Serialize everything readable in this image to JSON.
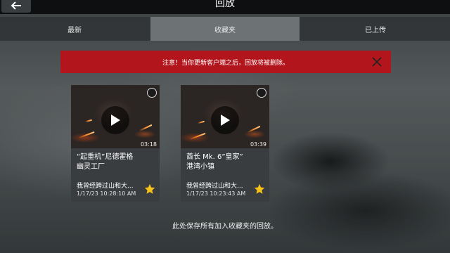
{
  "header": {
    "title": "回放"
  },
  "tabs": [
    {
      "label": "最新",
      "active": false
    },
    {
      "label": "收藏夹",
      "active": true
    },
    {
      "label": "已上传",
      "active": false
    }
  ],
  "notice": {
    "text": "注意！当你更新客户端之后，回放将被删除。"
  },
  "cards": [
    {
      "title_line1": "“起重机”尼德霍格",
      "title_line2": "幽灵工厂",
      "duration": "03:18",
      "description": "我曾经跨过山和大...",
      "date": "1/17/23 10:28:10 AM",
      "favorited": true
    },
    {
      "title_line1": "酋长 Mk. 6”皇家”",
      "title_line2": "港湾小镇",
      "duration": "03:39",
      "description": "我曾经跨过山和大...",
      "date": "1/17/23 10:23:43 AM",
      "favorited": true
    }
  ],
  "footer": {
    "note": "此处保存所有加入收藏夹的回放。"
  },
  "colors": {
    "notice_bg": "#b3151c",
    "star": "#f6c21a",
    "active_tab": "#787c7f"
  }
}
